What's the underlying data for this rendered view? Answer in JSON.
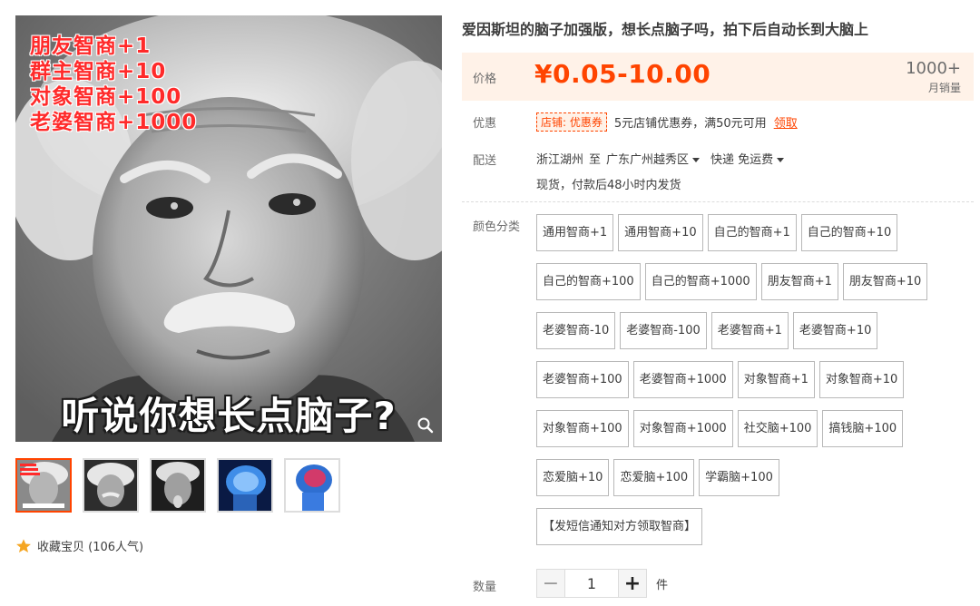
{
  "gallery": {
    "overlay_lines": [
      "朋友智商+1",
      "群主智商+10",
      "对象智商+100",
      "老婆智商+1000"
    ],
    "caption": "听说你想长点脑子?",
    "thumbnails": [
      {
        "label": "爱因斯坦表情包"
      },
      {
        "label": "爱因斯坦"
      },
      {
        "label": "爱因斯坦吐舌"
      },
      {
        "label": "蓝色大脑"
      },
      {
        "label": "彩色大脑"
      }
    ],
    "favorite": "收藏宝贝 (106人气)"
  },
  "product": {
    "title": "爱因斯坦的脑子加强版，想长点脑子吗，拍下后自动长到大脑上",
    "price_label": "价格",
    "price": "¥0.05-10.00",
    "sales_count": "1000+",
    "sales_label": "月销量",
    "promo_label": "优惠",
    "coupon_tag": "店铺: 优惠券",
    "promo_text": "5元店铺优惠券，满50元可用",
    "promo_link": "领取",
    "delivery_label": "配送",
    "origin": "浙江湖州",
    "to": "至",
    "destination": "广东广州越秀区",
    "shipping_method": "快递 免运费",
    "stock_note": "现货，付款后48小时内发货",
    "sku_label": "颜色分类",
    "sku_rows": [
      [
        "通用智商+1",
        "通用智商+10",
        "自己的智商+1",
        "自己的智商+10"
      ],
      [
        "自己的智商+100",
        "自己的智商+1000",
        "朋友智商+1",
        "朋友智商+10"
      ],
      [
        "老婆智商-10",
        "老婆智商-100",
        "老婆智商+1",
        "老婆智商+10"
      ],
      [
        "老婆智商+100",
        "老婆智商+1000",
        "对象智商+1",
        "对象智商+10"
      ],
      [
        "对象智商+100",
        "对象智商+1000",
        "社交脑+100",
        "搞钱脑+100"
      ],
      [
        "恋爱脑+10",
        "恋爱脑+100",
        "学霸脑+100"
      ],
      [
        "【发短信通知对方领取智商】"
      ]
    ],
    "qty_label": "数量",
    "qty_value": "1",
    "qty_minus": "−",
    "qty_plus": "+",
    "qty_unit": "件"
  },
  "colors": {
    "accent": "#ff4400",
    "price_bg": "#fff2e8",
    "overlay_red": "#ff2a2a"
  }
}
